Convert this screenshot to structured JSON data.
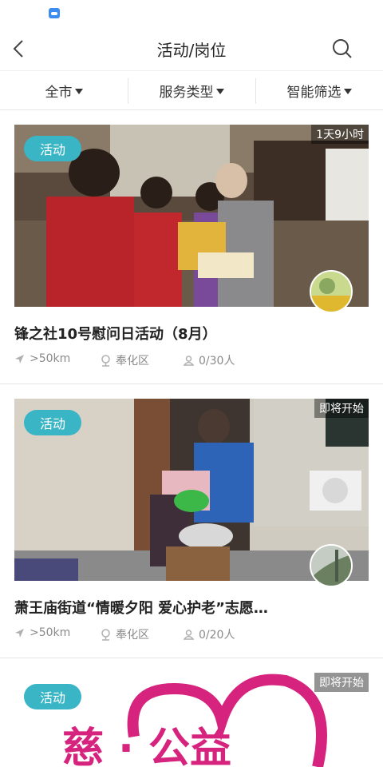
{
  "header": {
    "title": "活动/岗位"
  },
  "filters": [
    {
      "label": "全市"
    },
    {
      "label": "服务类型"
    },
    {
      "label": "智能筛选"
    }
  ],
  "cards": [
    {
      "badge": "活动",
      "time_status": "1天9小时",
      "title": "锋之社10号慰问日活动（8月）",
      "distance": ">50km",
      "district": "奉化区",
      "participants": "0/30人"
    },
    {
      "badge": "活动",
      "time_status": "即将开始",
      "title": "萧王庙街道“情暖夕阳  爱心护老”志愿…",
      "distance": ">50km",
      "district": "奉化区",
      "participants": "0/20人"
    },
    {
      "badge": "活动",
      "time_status": "即将开始",
      "logo_text": "慈 · 公益"
    }
  ],
  "colors": {
    "badge": "#39b5c6",
    "logo": "#d6247e"
  }
}
